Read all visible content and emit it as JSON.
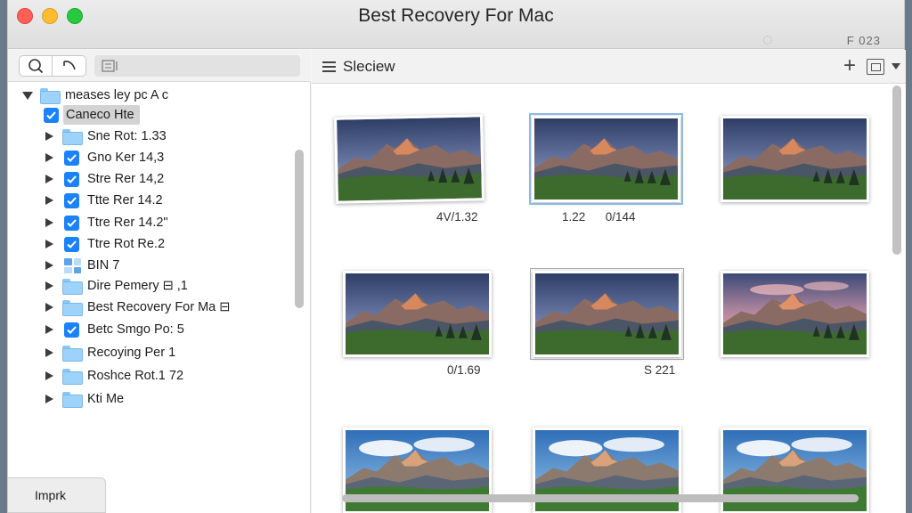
{
  "window": {
    "title": "Best Recovery For Mac",
    "version": "F 023"
  },
  "sidebar": {
    "tree": [
      {
        "label": "meases ley pc  A c",
        "icon": "folder-icon",
        "expanded": true,
        "checked": false
      },
      {
        "label": "Caneco Hte",
        "icon": "checkbox-icon",
        "checked": true,
        "selected": true
      },
      {
        "label": "Sne Rot: 1.33",
        "icon": "folder-icon",
        "checked": false
      },
      {
        "label": "Gno Ker 14,3",
        "icon": "checkbox-icon",
        "checked": true
      },
      {
        "label": "Stre Rer 14,2",
        "icon": "checkbox-icon",
        "checked": true
      },
      {
        "label": "Ttte Rer 14.2",
        "icon": "checkbox-icon",
        "checked": true
      },
      {
        "label": "Ttre Rer 14.2\"",
        "icon": "checkbox-icon",
        "checked": true
      },
      {
        "label": "Ttre Rot Re.2",
        "icon": "checkbox-icon",
        "checked": true
      },
      {
        "label": "BIN 7",
        "icon": "grid-icon",
        "checked": false
      },
      {
        "label": "Dire Pemery ⊟ ,1",
        "icon": "folder-icon",
        "checked": false
      },
      {
        "label": "Best Recovery For Ma ⊟",
        "icon": "folder-icon",
        "checked": false
      },
      {
        "label": "Betc Smgo Po: 5",
        "icon": "checkbox-icon",
        "checked": true
      },
      {
        "label": "Recoying Per 1",
        "icon": "folder-icon",
        "checked": false
      },
      {
        "label": "Roshce Rot.1 72",
        "icon": "folder-icon",
        "checked": false
      },
      {
        "label": "Kti Me",
        "icon": "folder-icon",
        "checked": false
      }
    ],
    "bottom_tab": "Imprk"
  },
  "main": {
    "view_title": "Sleciew",
    "thumbnails": [
      {
        "caption": "4V/1.32",
        "sky": "dusk"
      },
      {
        "caption": "1.22      0/144",
        "sky": "dusk",
        "selected": true
      },
      {
        "caption": "",
        "sky": "dusk"
      },
      {
        "caption": "0/1.69",
        "sky": "dusk"
      },
      {
        "caption": "S 221",
        "sky": "dusk",
        "framed": true
      },
      {
        "caption": "",
        "sky": "pink"
      },
      {
        "caption": "",
        "sky": "day"
      },
      {
        "caption": "",
        "sky": "day"
      },
      {
        "caption": "",
        "sky": "day"
      }
    ]
  },
  "colors": {
    "accent": "#1a82fb",
    "folder": "#9dd2fb",
    "close": "#fe5f57",
    "minimize": "#febc2e",
    "zoom": "#28c840"
  }
}
